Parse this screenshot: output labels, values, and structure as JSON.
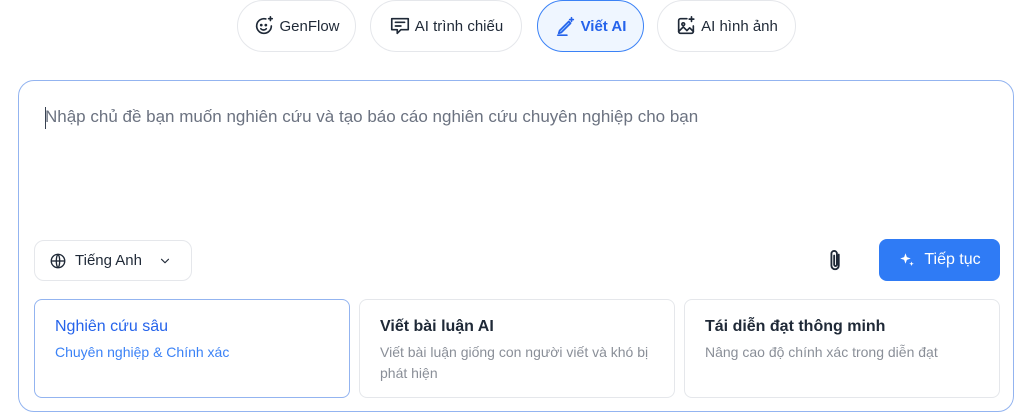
{
  "tabs": [
    {
      "label": "GenFlow",
      "icon": "smile-sparkle-icon"
    },
    {
      "label": "AI trình chiếu",
      "icon": "presentation-chat-icon"
    },
    {
      "label": "Viết AI",
      "icon": "pen-sparkle-icon",
      "active": true
    },
    {
      "label": "AI hình ảnh",
      "icon": "image-sparkle-icon"
    }
  ],
  "prompt": {
    "placeholder": "Nhập chủ đề bạn muốn nghiên cứu và tạo báo cáo nghiên cứu chuyên nghiệp cho bạn",
    "value": ""
  },
  "language": {
    "selected": "Tiếng Anh",
    "icon": "globe-icon"
  },
  "submit": {
    "label": "Tiếp tục",
    "icon": "sparkle-icon"
  },
  "options": [
    {
      "title": "Nghiên cứu sâu",
      "desc": "Chuyên nghiệp & Chính xác",
      "selected": true
    },
    {
      "title": "Viết bài luận AI",
      "desc": "Viết bài luận giống con người viết và khó bị phát hiện"
    },
    {
      "title": "Tái diễn đạt thông minh",
      "desc": "Nâng cao độ chính xác trong diễn đạt"
    }
  ],
  "colors": {
    "accent": "#2f7bf5",
    "active_tab_bg": "#eff6ff",
    "border": "#e5e7eb"
  }
}
